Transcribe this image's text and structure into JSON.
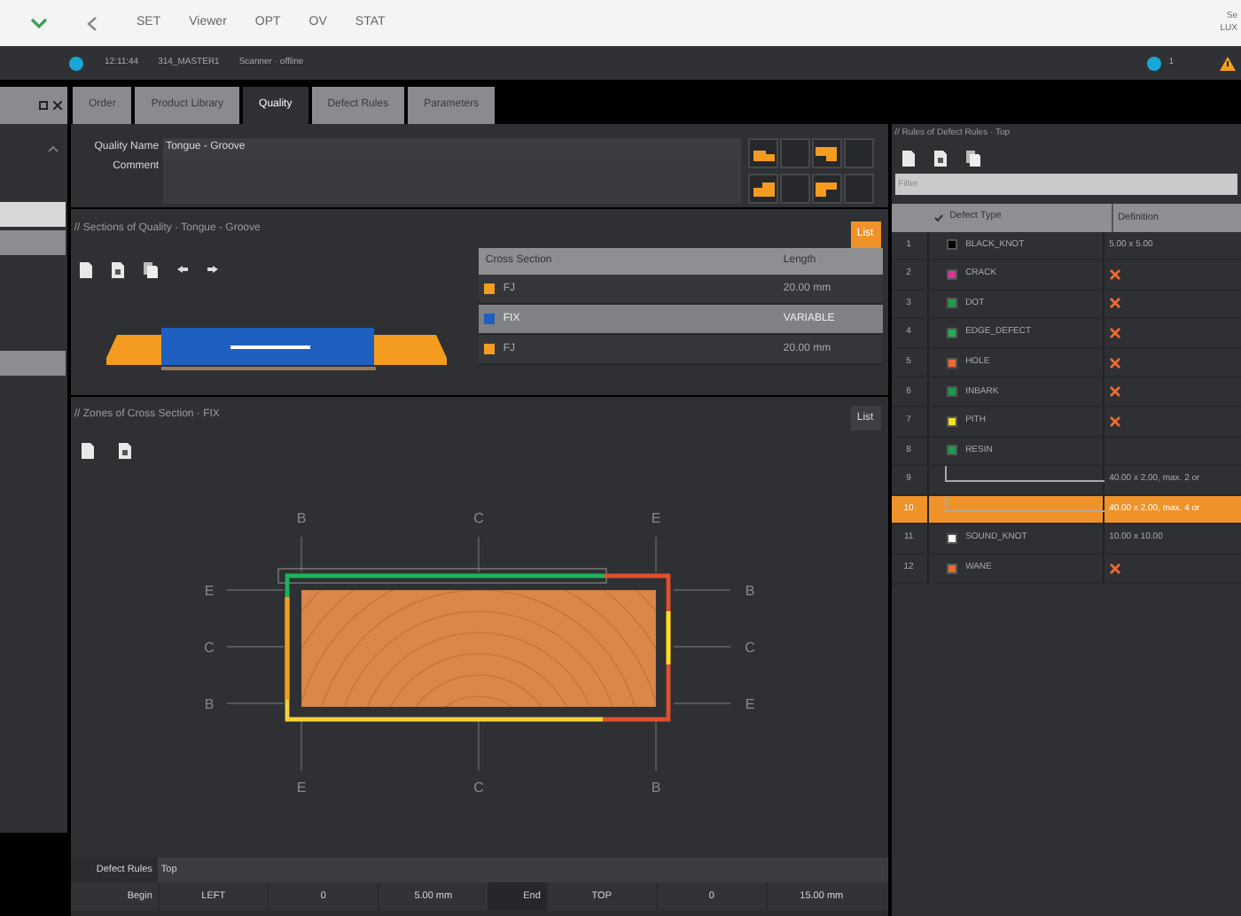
{
  "top_menu": {
    "items": [
      "SET",
      "Viewer",
      "OPT",
      "OV",
      "STAT"
    ],
    "corner": [
      "Se",
      "LUX"
    ]
  },
  "status_bar": {
    "time": "12:11:44",
    "station": "314_MASTER1",
    "scanner": "Scanner · offline",
    "count": "1"
  },
  "sidebar": {
    "rows": [
      {
        "selected": true
      },
      {
        "selected": false
      },
      {
        "selected": false
      }
    ]
  },
  "tabs": [
    {
      "label": "Order",
      "selected": false
    },
    {
      "label": "Product Library",
      "selected": false
    },
    {
      "label": "Quality",
      "selected": true
    },
    {
      "label": "Defect Rules",
      "selected": false
    },
    {
      "label": "Parameters",
      "selected": false
    }
  ],
  "quality": {
    "name_label": "Quality Name",
    "name": "Tongue - Groove",
    "comment_label": "Comment"
  },
  "sections": {
    "title": "// Sections of Quality · Tongue - Groove",
    "list_button": "List",
    "columns": [
      "Cross Section",
      "Length"
    ],
    "rows": [
      {
        "name": "FJ",
        "length": "20.00 mm",
        "color": "#f39c1f",
        "selected": false
      },
      {
        "name": "FIX",
        "length": "VARIABLE",
        "color": "#1f5fbf",
        "selected": true
      },
      {
        "name": "FJ",
        "length": "20.00 mm",
        "color": "#f39c1f",
        "selected": false
      }
    ]
  },
  "zones": {
    "title": "// Zones of Cross Section · FIX",
    "list_button": "List",
    "labels": {
      "top": [
        "B",
        "C",
        "E"
      ],
      "left": [
        "E",
        "C",
        "B"
      ],
      "right": [
        "B",
        "C",
        "E"
      ],
      "bottom": [
        "E",
        "C",
        "B"
      ]
    }
  },
  "footer": {
    "rules_label": "Defect Rules",
    "rules_value": "Top",
    "begin_label": "Begin",
    "cells": [
      "LEFT",
      "0",
      "5.00 mm"
    ],
    "end_label": "End",
    "end_cells": [
      "TOP",
      "0",
      "15.00 mm"
    ]
  },
  "rules": {
    "title": "// Rules of Defect Rules · Top",
    "filter_placeholder": "Filter",
    "columns": [
      "Defect Type",
      "Definition"
    ],
    "rows": [
      {
        "number": "1",
        "name": "BLACK_KNOT",
        "color": "#000000",
        "kind": "text",
        "definition": "5.00 x 5.00",
        "selected": false
      },
      {
        "number": "2",
        "name": "CRACK",
        "color": "#e0309a",
        "kind": "x",
        "selected": false
      },
      {
        "number": "3",
        "name": "DOT",
        "color": "#1aa04a",
        "kind": "x",
        "selected": false
      },
      {
        "number": "4",
        "name": "EDGE_DEFECT",
        "color": "#22b04f",
        "kind": "x",
        "selected": false
      },
      {
        "number": "5",
        "name": "HOLE",
        "color": "#f06a30",
        "kind": "x",
        "selected": false
      },
      {
        "number": "6",
        "name": "INBARK",
        "color": "#1a9a4a",
        "kind": "x",
        "selected": false
      },
      {
        "number": "7",
        "name": "PITH",
        "color": "#f5e020",
        "kind": "x",
        "selected": false
      },
      {
        "number": "8",
        "name": "RESIN",
        "color": "#1aa04a",
        "kind": "none",
        "selected": false
      },
      {
        "number": "9",
        "kind": "sub",
        "definition": "40.00 x 2.00, max. 2 or",
        "selected": false
      },
      {
        "number": "10",
        "kind": "sub",
        "definition": "40.00 x 2.00, max. 4 or",
        "selected": true
      },
      {
        "number": "11",
        "name": "SOUND_KNOT",
        "color": "#ffffff",
        "kind": "text",
        "definition": "10.00 x 10.00",
        "selected": false
      },
      {
        "number": "12",
        "name": "WANE",
        "color": "#f06a30",
        "kind": "x",
        "selected": false
      }
    ]
  }
}
